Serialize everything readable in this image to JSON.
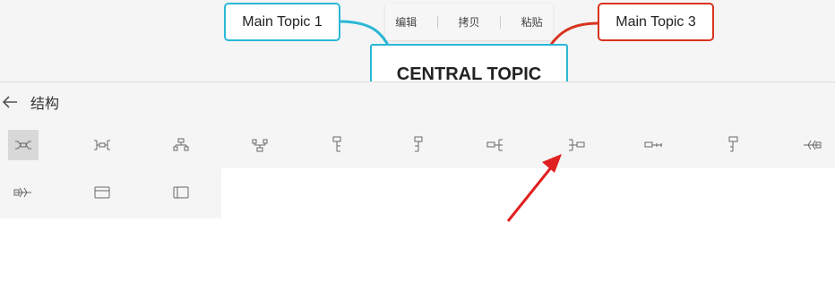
{
  "canvas": {
    "topics": [
      {
        "label": "Main Topic 1",
        "color": "#2ab8d6"
      },
      {
        "label": "Main Topic 3",
        "color": "#d9331f"
      }
    ],
    "central": {
      "label": "CENTRAL TOPIC",
      "color": "#2ab8d6"
    },
    "context_menu": {
      "edit": "编辑",
      "copy": "拷贝",
      "paste": "粘贴"
    }
  },
  "panel": {
    "title": "结构",
    "structure_icons": [
      "mind-map-icon",
      "logic-chart-both-icon",
      "org-chart-down-icon",
      "org-chart-up-icon",
      "tree-chart-right-icon",
      "tree-chart-left-icon",
      "logic-chart-left-icon",
      "logic-chart-right-icon",
      "timeline-horizontal-icon",
      "tree-table-icon",
      "fishbone-left-icon",
      "fishbone-right-icon",
      "matrix-icon",
      "brace-map-icon"
    ],
    "selected_index": 0
  },
  "annotation": {
    "arrow_color": "#e02020"
  }
}
